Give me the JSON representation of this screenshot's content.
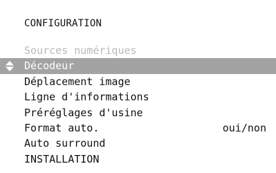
{
  "menu_title": "CONFIGURATION",
  "items": [
    {
      "label": "Sources numériques",
      "state": "disabled"
    },
    {
      "label": "Décodeur",
      "state": "selected"
    },
    {
      "label": "Déplacement image"
    },
    {
      "label": "Ligne d'informations"
    },
    {
      "label": "Préréglages d'usine"
    },
    {
      "label": "Format auto.",
      "value": "oui/non"
    },
    {
      "label": "Auto surround"
    },
    {
      "label": "INSTALLATION"
    }
  ],
  "selection_icon": "up-down-arrows-icon",
  "colors": {
    "background": "#ffffff",
    "text": "#111111",
    "disabled_text": "#b9b9b9",
    "selection_bar": "#a3a3a3",
    "selected_text": "#ffffff"
  }
}
